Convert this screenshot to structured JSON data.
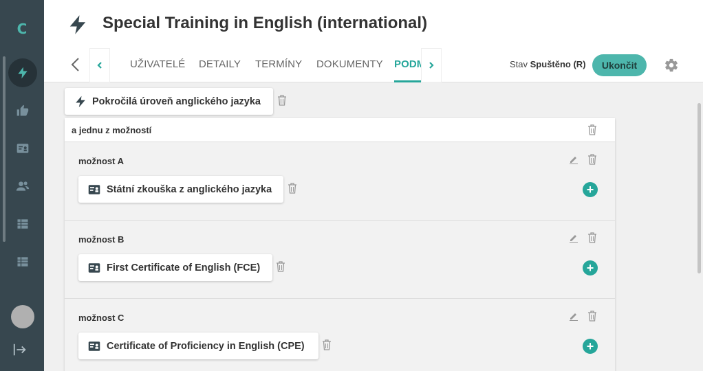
{
  "sidebar": {
    "logo": "C",
    "items": [
      {
        "icon": "bolt-icon",
        "active": true
      },
      {
        "icon": "thumbs-up-icon",
        "active": false
      },
      {
        "icon": "id-card-icon",
        "active": false
      },
      {
        "icon": "users-icon",
        "active": false
      },
      {
        "icon": "table-icon",
        "active": false
      },
      {
        "icon": "table-icon",
        "active": false
      }
    ]
  },
  "header": {
    "title": "Special Training in English (international)",
    "tabs": [
      "UŽIVATELÉ",
      "DETAILY",
      "TERMÍNY",
      "DOKUMENTY",
      "PODM"
    ],
    "active_tab": "PODM",
    "status_label": "Stav",
    "status_value": "Spuštěno (R)",
    "end_button": "Ukončit"
  },
  "content": {
    "top_condition": "Pokročilá úroveň anglického jazyka",
    "group_title": "a jednu z možností",
    "options": [
      {
        "title": "možnost A",
        "item": "Státní zkouška z anglického jazyka"
      },
      {
        "title": "možnost B",
        "item": "First Certificate of English (FCE)"
      },
      {
        "title": "možnost C",
        "item": "Certificate of Proficiency in English (CPE)"
      }
    ]
  },
  "colors": {
    "sidebar_bg": "#37474f",
    "accent": "#26a69a",
    "accent_light": "#4db6ac"
  }
}
